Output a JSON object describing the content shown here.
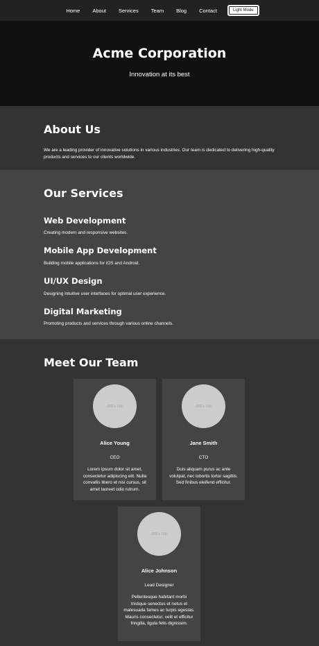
{
  "nav": {
    "links": [
      "Home",
      "About",
      "Services",
      "Team",
      "Blog",
      "Contact"
    ],
    "mode_button": "Light Mode"
  },
  "hero": {
    "title": "Acme Corporation",
    "subtitle": "Innovation at its best"
  },
  "about": {
    "title": "About Us",
    "text": "We are a leading provider of innovative solutions in various industries. Our team is dedicated to delivering high-quality products and services to our clients worldwide."
  },
  "services": {
    "title": "Our Services",
    "items": [
      {
        "title": "Web Development",
        "desc": "Creating modern and responsive websites."
      },
      {
        "title": "Mobile App Development",
        "desc": "Building mobile applications for iOS and Android."
      },
      {
        "title": "UI/UX Design",
        "desc": "Designing intuitive user interfaces for optimal user experience."
      },
      {
        "title": "Digital Marketing",
        "desc": "Promoting products and services through various online channels."
      }
    ]
  },
  "team": {
    "title": "Meet Our Team",
    "members": [
      {
        "placeholder": "150 x 150",
        "name": "Alice Young",
        "role": "CEO",
        "bio": "Lorem ipsum dolor sit amet, consectetur adipiscing elit. Nulla convallis libero et nisi cursus, sit amet laoreet odio rutrum."
      },
      {
        "placeholder": "150 x 150",
        "name": "Jane Smith",
        "role": "CTO",
        "bio": "Duis aliquam purus ac ante volutpat, nec lobortis tortor sagittis. Sed finibus eleifend efficitur."
      },
      {
        "placeholder": "150 x 150",
        "name": "Alice Johnson",
        "role": "Lead Designer",
        "bio": "Pellentesque habitant morbi tristique senectus et netus et malesuada fames ac turpis egestas. Mauris consectetur, velit et efficitur fringilla, ligula felis dignissim."
      }
    ]
  }
}
